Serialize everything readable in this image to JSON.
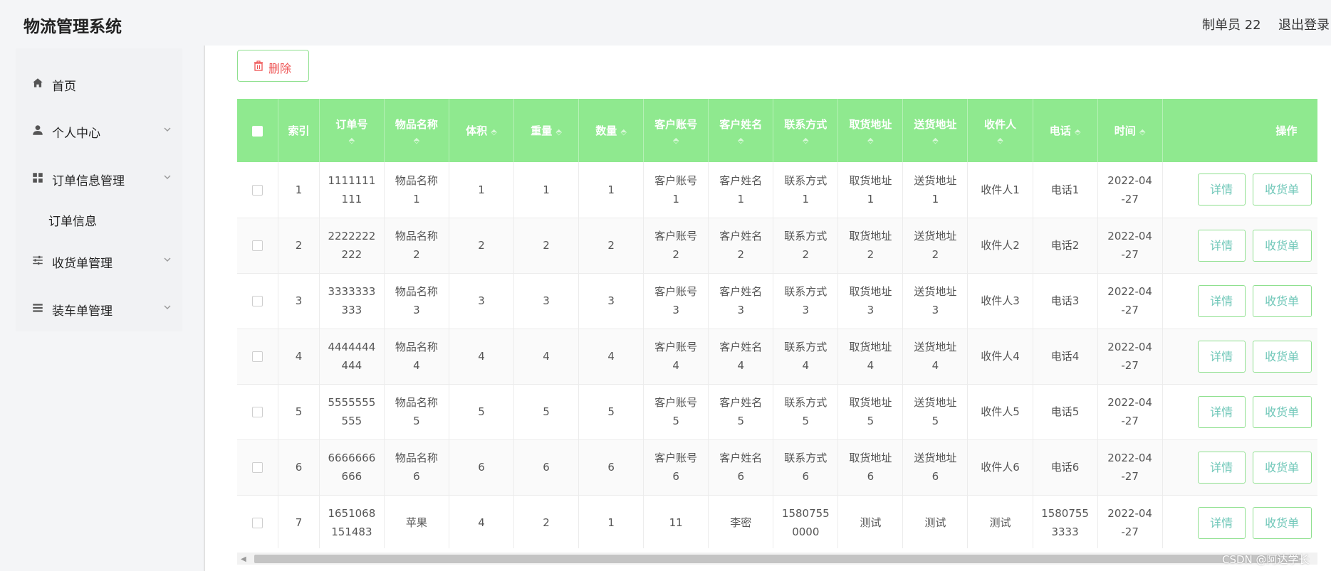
{
  "header": {
    "app_title": "物流管理系统",
    "user_label": "制单员 22",
    "logout_label": "退出登录"
  },
  "sidebar": {
    "items": [
      {
        "label": "首页",
        "icon": "home-icon"
      },
      {
        "label": "个人中心",
        "icon": "user-icon"
      },
      {
        "label": "订单信息管理",
        "icon": "grid-icon"
      },
      {
        "label": "收货单管理",
        "icon": "sliders-icon"
      },
      {
        "label": "装车单管理",
        "icon": "list-icon"
      }
    ],
    "submenu": {
      "label": "订单信息"
    }
  },
  "toolbar": {
    "delete_label": "删除",
    "delete_icon": "trash-icon"
  },
  "table": {
    "columns": [
      "索引",
      "订单号",
      "物品名称",
      "体积",
      "重量",
      "数量",
      "客户账号",
      "客户姓名",
      "联系方式",
      "取货地址",
      "送货地址",
      "收件人",
      "电话",
      "时间",
      "操作"
    ],
    "sort_glyph": "⬘",
    "rows": [
      {
        "index": "1",
        "order_no": [
          "1111111",
          "111"
        ],
        "item_name": [
          "物品名称",
          "1"
        ],
        "volume": "1",
        "weight": "1",
        "quantity": "1",
        "account": [
          "客户账号",
          "1"
        ],
        "customer": [
          "客户姓名",
          "1"
        ],
        "contact": [
          "联系方式",
          "1"
        ],
        "pickup": [
          "取货地址",
          "1"
        ],
        "delivery": [
          "送货地址",
          "1"
        ],
        "recipient": "收件人1",
        "phone": "电话1",
        "time": [
          "2022-04",
          "-27"
        ]
      },
      {
        "index": "2",
        "order_no": [
          "2222222",
          "222"
        ],
        "item_name": [
          "物品名称",
          "2"
        ],
        "volume": "2",
        "weight": "2",
        "quantity": "2",
        "account": [
          "客户账号",
          "2"
        ],
        "customer": [
          "客户姓名",
          "2"
        ],
        "contact": [
          "联系方式",
          "2"
        ],
        "pickup": [
          "取货地址",
          "2"
        ],
        "delivery": [
          "送货地址",
          "2"
        ],
        "recipient": "收件人2",
        "phone": "电话2",
        "time": [
          "2022-04",
          "-27"
        ]
      },
      {
        "index": "3",
        "order_no": [
          "3333333",
          "333"
        ],
        "item_name": [
          "物品名称",
          "3"
        ],
        "volume": "3",
        "weight": "3",
        "quantity": "3",
        "account": [
          "客户账号",
          "3"
        ],
        "customer": [
          "客户姓名",
          "3"
        ],
        "contact": [
          "联系方式",
          "3"
        ],
        "pickup": [
          "取货地址",
          "3"
        ],
        "delivery": [
          "送货地址",
          "3"
        ],
        "recipient": "收件人3",
        "phone": "电话3",
        "time": [
          "2022-04",
          "-27"
        ]
      },
      {
        "index": "4",
        "order_no": [
          "4444444",
          "444"
        ],
        "item_name": [
          "物品名称",
          "4"
        ],
        "volume": "4",
        "weight": "4",
        "quantity": "4",
        "account": [
          "客户账号",
          "4"
        ],
        "customer": [
          "客户姓名",
          "4"
        ],
        "contact": [
          "联系方式",
          "4"
        ],
        "pickup": [
          "取货地址",
          "4"
        ],
        "delivery": [
          "送货地址",
          "4"
        ],
        "recipient": "收件人4",
        "phone": "电话4",
        "time": [
          "2022-04",
          "-27"
        ]
      },
      {
        "index": "5",
        "order_no": [
          "5555555",
          "555"
        ],
        "item_name": [
          "物品名称",
          "5"
        ],
        "volume": "5",
        "weight": "5",
        "quantity": "5",
        "account": [
          "客户账号",
          "5"
        ],
        "customer": [
          "客户姓名",
          "5"
        ],
        "contact": [
          "联系方式",
          "5"
        ],
        "pickup": [
          "取货地址",
          "5"
        ],
        "delivery": [
          "送货地址",
          "5"
        ],
        "recipient": "收件人5",
        "phone": "电话5",
        "time": [
          "2022-04",
          "-27"
        ]
      },
      {
        "index": "6",
        "order_no": [
          "6666666",
          "666"
        ],
        "item_name": [
          "物品名称",
          "6"
        ],
        "volume": "6",
        "weight": "6",
        "quantity": "6",
        "account": [
          "客户账号",
          "6"
        ],
        "customer": [
          "客户姓名",
          "6"
        ],
        "contact": [
          "联系方式",
          "6"
        ],
        "pickup": [
          "取货地址",
          "6"
        ],
        "delivery": [
          "送货地址",
          "6"
        ],
        "recipient": "收件人6",
        "phone": "电话6",
        "time": [
          "2022-04",
          "-27"
        ]
      },
      {
        "index": "7",
        "order_no": [
          "1651068",
          "151483"
        ],
        "item_name": [
          "苹果"
        ],
        "volume": "4",
        "weight": "2",
        "quantity": "1",
        "account": [
          "11"
        ],
        "customer": [
          "李密"
        ],
        "contact": [
          "1580755",
          "0000"
        ],
        "pickup": [
          "测试"
        ],
        "delivery": [
          "测试"
        ],
        "recipient": "测试",
        "phone": [
          "1580755",
          "3333"
        ],
        "time": [
          "2022-04",
          "-27"
        ]
      }
    ],
    "row_actions": [
      "详情",
      "收货单"
    ]
  },
  "watermark": "CSDN @阿达学长",
  "colors": {
    "header_green": "#8fe98f",
    "button_text": "#6fc7b8",
    "delete_text": "#e55555"
  }
}
